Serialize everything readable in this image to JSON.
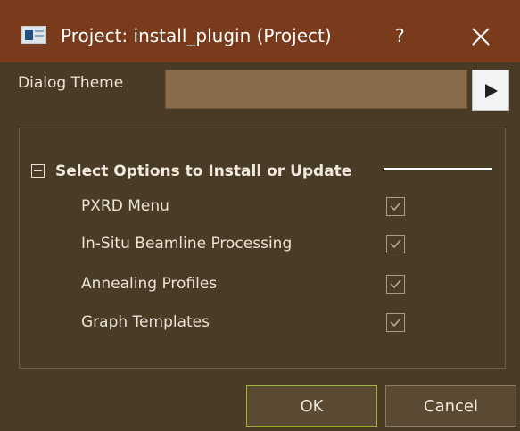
{
  "window": {
    "title": "Project: install_plugin (Project)",
    "help_label": "?",
    "close_icon": "close-icon"
  },
  "theme": {
    "label": "Dialog Theme",
    "value": "",
    "arrow_icon": "play-arrow-icon"
  },
  "group": {
    "heading": "Select Options to Install or Update",
    "collapse_icon": "collapse-minus-icon",
    "options": [
      {
        "label": "PXRD Menu",
        "checked": true
      },
      {
        "label": "In-Situ Beamline Processing",
        "checked": true
      },
      {
        "label": "Annealing Profiles",
        "checked": true
      },
      {
        "label": "Graph Templates",
        "checked": true
      }
    ]
  },
  "buttons": {
    "ok_label": "OK",
    "cancel_label": "Cancel"
  },
  "colors": {
    "title_bar": "#7a3b1d",
    "dialog_background": "#4a3b26",
    "theme_field": "#8a6c4b",
    "ok_focus_border": "#9bb63a"
  }
}
